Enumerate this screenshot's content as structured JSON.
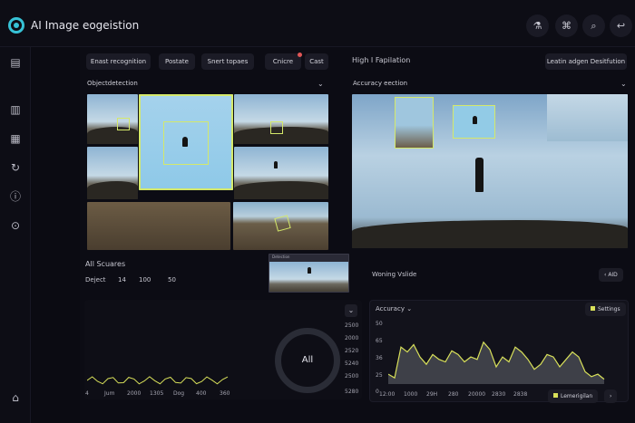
{
  "app": {
    "title": "AI Image eogeistion"
  },
  "topbar": {
    "icons": [
      "flask-icon",
      "tag-icon",
      "search-icon",
      "back-icon"
    ]
  },
  "sidebar": {
    "icons": [
      "document-icon",
      "bar-chart-icon",
      "report-icon",
      "refresh-icon",
      "info-icon",
      "help-icon",
      "home-icon"
    ]
  },
  "toolbar": {
    "buttons": [
      "Enast recognition",
      "Postate",
      "Snert topaes",
      "Cnicre",
      "Cast"
    ],
    "right_title": "High I Fapilation",
    "right_button": "Leatin adgen Desitfution"
  },
  "left_panel": {
    "title": "Objectdetection"
  },
  "right_panel": {
    "title": "Accuracy eection"
  },
  "squares": {
    "title": "All Scuares",
    "label": "Deject",
    "values": [
      "14",
      "100",
      "50"
    ]
  },
  "thumbnail": {
    "caption": "Detection"
  },
  "warning": {
    "title": "Woning Vslide",
    "button": "AID"
  },
  "left_chart": {
    "x_ticks": [
      "4",
      "Jum",
      "2000",
      "1305",
      "Dog",
      "400",
      "360"
    ],
    "y_ticks": [
      "2500",
      "2000",
      "2520",
      "5240",
      "2500",
      "5280"
    ],
    "donut_label": "All"
  },
  "accuracy_card": {
    "title": "Accuracy",
    "settings_label": "Settings",
    "y_ticks": [
      "50",
      "65",
      "36",
      "25",
      "0"
    ],
    "x_ticks": [
      "12:00",
      "1000",
      "29H",
      "280",
      "20000",
      "2830",
      "2838"
    ],
    "legend": "Lemerigilan"
  },
  "chart_data": [
    {
      "type": "line",
      "x": [
        "4",
        "Jum",
        "2000",
        "1305",
        "Dog",
        "400",
        "360"
      ],
      "series": [
        {
          "values": [
            2500,
            2500,
            2500,
            2520,
            2500,
            2500,
            2520
          ]
        }
      ],
      "ylim": [
        2500,
        5280
      ]
    },
    {
      "type": "area",
      "x": [
        "12:00",
        "1000",
        "29H",
        "280",
        "20000",
        "2830",
        "2838"
      ],
      "series": [
        {
          "values": [
            8,
            5,
            30,
            26,
            32,
            22,
            16,
            24,
            20,
            18,
            27,
            24,
            18,
            22,
            20,
            34,
            28,
            14,
            22,
            18,
            30,
            26,
            20,
            12,
            16,
            24,
            22,
            14,
            20,
            26,
            22,
            10,
            6,
            8,
            4
          ]
        }
      ],
      "ylim": [
        0,
        50
      ],
      "colors": {
        "line": "#d8e05a",
        "fill": "#3e4048"
      }
    }
  ]
}
